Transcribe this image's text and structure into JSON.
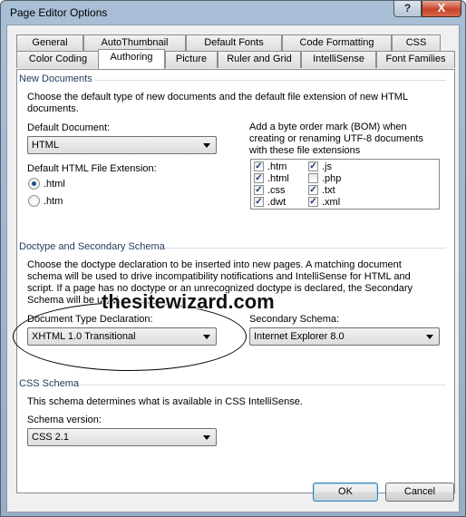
{
  "window": {
    "title": "Page Editor Options",
    "help_glyph": "?",
    "close_glyph": "X"
  },
  "tabs": {
    "row1": [
      "General",
      "AutoThumbnail",
      "Default Fonts",
      "Code Formatting",
      "CSS"
    ],
    "row2": [
      "Color Coding",
      "Authoring",
      "Picture",
      "Ruler and Grid",
      "IntelliSense",
      "Font Families"
    ],
    "active": "Authoring"
  },
  "new_documents": {
    "header": "New Documents",
    "description": "Choose the default type of new documents and the default file extension of new HTML documents.",
    "default_document_label": "Default Document:",
    "default_document_value": "HTML",
    "extension_label": "Default HTML File Extension:",
    "radio_options": [
      {
        "label": ".html",
        "checked": true
      },
      {
        "label": ".htm",
        "checked": false
      }
    ],
    "bom_text": "Add a byte order mark (BOM) when creating or renaming UTF-8 documents with these file extensions",
    "bom_extensions": [
      {
        "label": ".htm",
        "checked": true
      },
      {
        "label": ".html",
        "checked": true
      },
      {
        "label": ".css",
        "checked": true
      },
      {
        "label": ".dwt",
        "checked": true
      },
      {
        "label": ".js",
        "checked": true
      },
      {
        "label": ".php",
        "checked": false
      },
      {
        "label": ".txt",
        "checked": true
      },
      {
        "label": ".xml",
        "checked": true
      }
    ]
  },
  "doctype": {
    "header": "Doctype and Secondary Schema",
    "description": "Choose the doctype declaration to be inserted into new pages. A matching document schema will be used to drive incompatibility notifications and IntelliSense for HTML and script. If a page has no doctype or an unrecognized doctype is declared, the Secondary Schema will be used.",
    "doctype_label": "Document Type Declaration:",
    "doctype_value": "XHTML 1.0 Transitional",
    "secondary_label": "Secondary Schema:",
    "secondary_value": "Internet Explorer 8.0"
  },
  "watermark": "thesitewizard.com",
  "css_schema": {
    "header": "CSS Schema",
    "description": "This schema determines what is available in CSS IntelliSense.",
    "version_label": "Schema version:",
    "version_value": "CSS 2.1"
  },
  "buttons": {
    "ok": "OK",
    "cancel": "Cancel"
  },
  "colors": {
    "section_header": "#1e395b",
    "title_bar": "#a9bfd6",
    "close_button": "#c7432a"
  }
}
